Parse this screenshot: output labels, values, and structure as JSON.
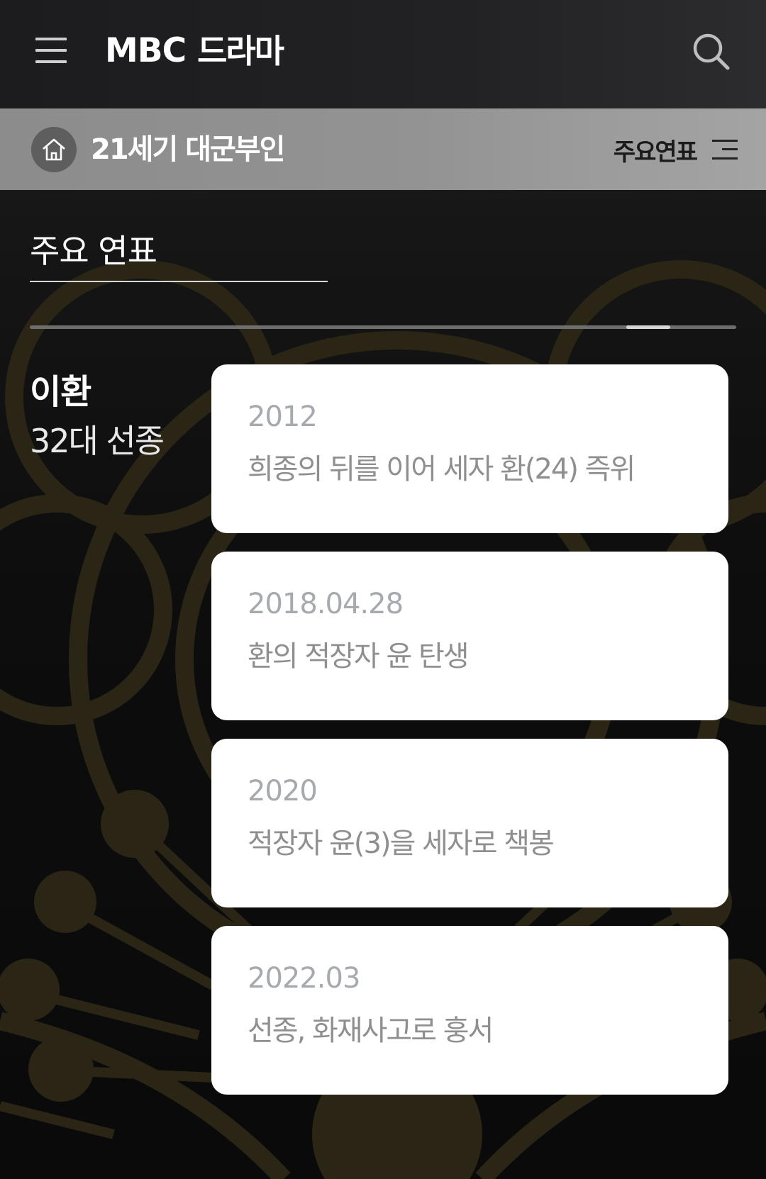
{
  "header": {
    "logo_text": "MBC",
    "logo_sub": "드라마"
  },
  "subnav": {
    "program_title": "21세기 대군부인",
    "section_menu_label": "주요연표"
  },
  "page": {
    "heading": "주요 연표",
    "carousel_position": 0.9
  },
  "person": {
    "name": "이환",
    "role": "32대 선종"
  },
  "timeline": [
    {
      "date": "2012",
      "event": "희종의 뒤를 이어 세자 환(24) 즉위"
    },
    {
      "date": "2018.04.28",
      "event": "환의 적장자 윤 탄생"
    },
    {
      "date": "2020",
      "event": "적장자 윤(3)을 세자로 책봉"
    },
    {
      "date": "2022.03",
      "event": "선종, 화재사고로 훙서"
    }
  ],
  "colors": {
    "emblem": "#2b2516",
    "card_background": "#ffffff",
    "subnav_background": "#939393"
  },
  "icons": {
    "menu": "hamburger-icon",
    "search": "search-icon",
    "home": "home-icon",
    "section_menu": "list-icon"
  }
}
